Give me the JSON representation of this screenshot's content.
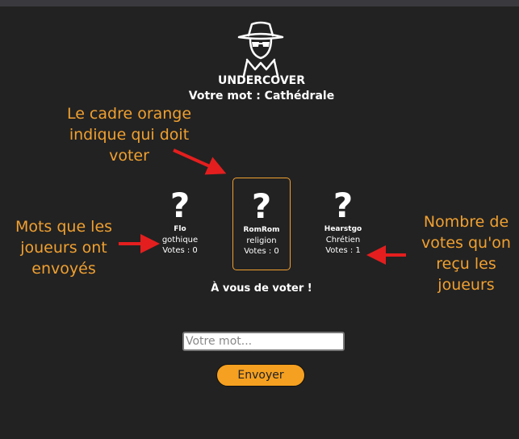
{
  "game": {
    "title": "UNDERCOVER",
    "word_line": "Votre mot : Cathédrale",
    "vote_prompt": "À vous de voter !"
  },
  "players": [
    {
      "name": "Flo",
      "word": "gothique",
      "votes": "Votes : 0",
      "icon": "question-mark-icon",
      "active": false
    },
    {
      "name": "RomRom",
      "word": "religion",
      "votes": "Votes : 0",
      "icon": "question-mark-icon",
      "active": true
    },
    {
      "name": "Hearstgo",
      "word": "Chrétien",
      "votes": "Votes : 1",
      "icon": "question-mark-icon",
      "active": false
    }
  ],
  "form": {
    "input_placeholder": "Votre mot...",
    "input_value": "",
    "submit_label": "Envoyer"
  },
  "annotations": {
    "orange_frame": "Le cadre orange indique qui doit voter",
    "sent_words": "Mots que les joueurs ont envoyés",
    "votes_received": "Nombre de votes qu'on reçu les joueurs"
  },
  "colors": {
    "background": "#222222",
    "accent_orange": "#f0a030",
    "button": "#f5a020",
    "arrow": "#e41e1e"
  }
}
